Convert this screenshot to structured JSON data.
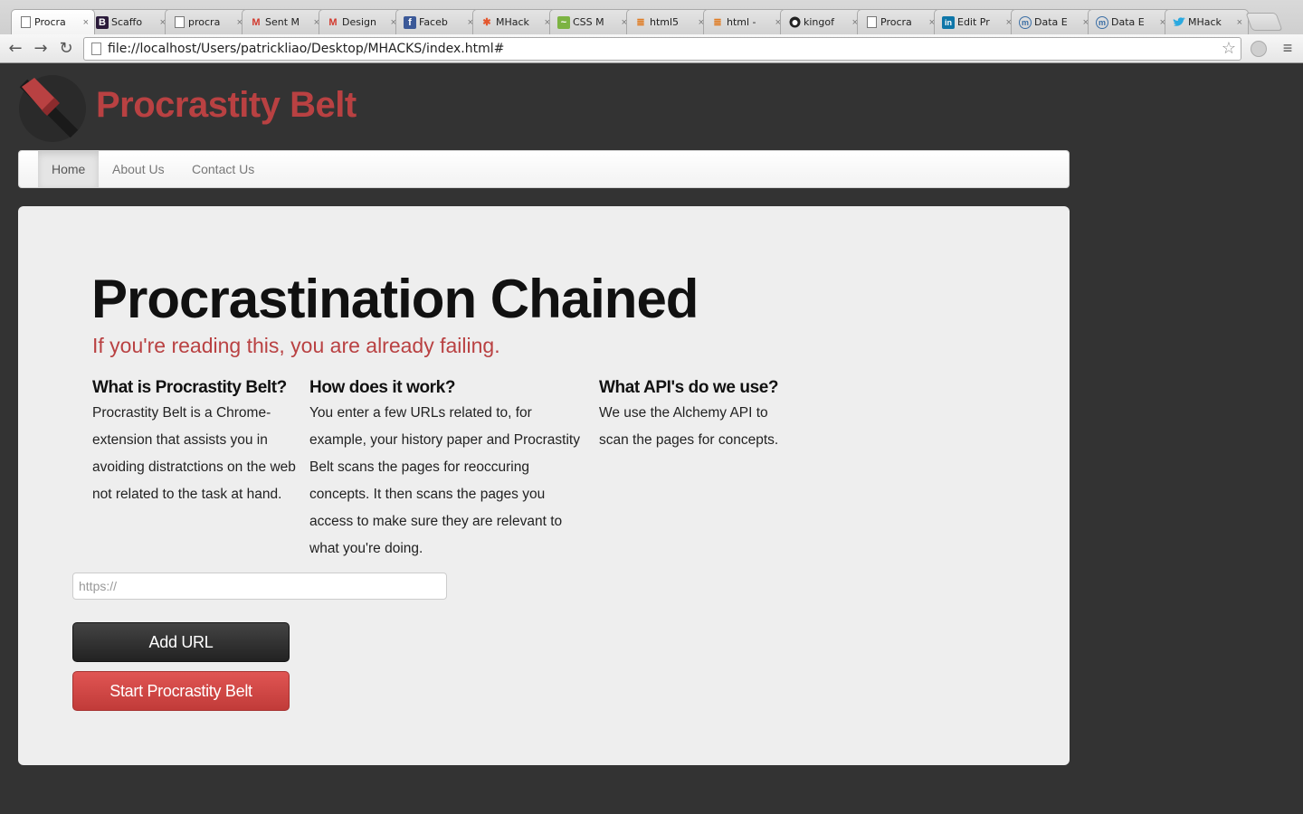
{
  "browser": {
    "tabs": [
      {
        "label": "Procra",
        "icon": "page-icon",
        "active": true
      },
      {
        "label": "Scaffo",
        "icon": "bootstrap-icon"
      },
      {
        "label": "procra",
        "icon": "page-icon"
      },
      {
        "label": "Sent M",
        "icon": "gmail-icon"
      },
      {
        "label": "Design",
        "icon": "gmail-icon"
      },
      {
        "label": "Faceb",
        "icon": "facebook-icon"
      },
      {
        "label": "MHack",
        "icon": "mhacks-icon"
      },
      {
        "label": "CSS M",
        "icon": "css-icon"
      },
      {
        "label": "html5",
        "icon": "stackoverflow-icon"
      },
      {
        "label": "html -",
        "icon": "stackoverflow-icon"
      },
      {
        "label": "kingof",
        "icon": "github-icon"
      },
      {
        "label": "Procra",
        "icon": "page-icon"
      },
      {
        "label": "Edit Pr",
        "icon": "linkedin-icon"
      },
      {
        "label": "Data E",
        "icon": "mashery-icon"
      },
      {
        "label": "Data E",
        "icon": "mashery-icon"
      },
      {
        "label": "MHack",
        "icon": "twitter-icon"
      }
    ],
    "close_glyph": "×",
    "address": "file://localhost/Users/patrickliao/Desktop/MHACKS/index.html#",
    "back_glyph": "←",
    "forward_glyph": "→",
    "reload_glyph": "↻",
    "star_glyph": "☆",
    "menu_glyph": "≡"
  },
  "site": {
    "brand": "Procrastity Belt",
    "brand_color": "#b94142",
    "nav": [
      {
        "label": "Home",
        "active": true
      },
      {
        "label": "About Us"
      },
      {
        "label": "Contact Us"
      }
    ]
  },
  "hero": {
    "title": "Procrastination Chained",
    "tagline": "If you're reading this, you are already failing.",
    "columns": [
      {
        "heading": "What is Procrastity Belt?",
        "body": "Procrastity Belt is a Chrome-extension that assists you in avoiding distratctions on the web not related to the task at hand."
      },
      {
        "heading": "How does it work?",
        "body": "You enter a few URLs related to, for example, your history paper and Procrastity Belt scans the pages for reoccuring concepts. It then scans the pages you access to make sure they are relevant to what you're doing."
      },
      {
        "heading": "What API's do we use?",
        "body": "We use the Alchemy API to scan the pages for concepts."
      }
    ],
    "url_placeholder": "https://",
    "url_value": "",
    "add_button": "Add URL",
    "start_button": "Start Procrastity Belt"
  }
}
